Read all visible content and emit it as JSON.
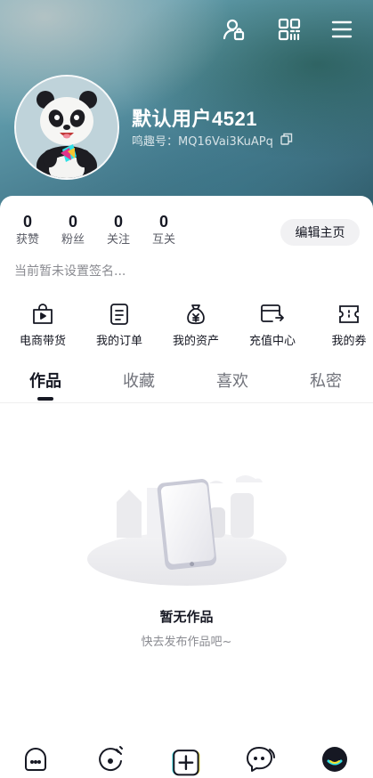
{
  "profile": {
    "username": "默认用户4521",
    "id_label": "鸣趣号：MQ16Vai3KuAPq"
  },
  "icons": {
    "add_friend": "person-add-icon",
    "qr_code": "qr-code-icon",
    "menu": "menu-icon",
    "copy": "copy-icon"
  },
  "stats": [
    {
      "value": "0",
      "label": "获赞"
    },
    {
      "value": "0",
      "label": "粉丝"
    },
    {
      "value": "0",
      "label": "关注"
    },
    {
      "value": "0",
      "label": "互关"
    }
  ],
  "edit_button": "编辑主页",
  "bio": "当前暂未设置签名...",
  "services": [
    {
      "label": "电商带货",
      "icon": "shopping-bag-play-icon"
    },
    {
      "label": "我的订单",
      "icon": "order-document-icon"
    },
    {
      "label": "我的资产",
      "icon": "money-bag-icon"
    },
    {
      "label": "充值中心",
      "icon": "recharge-card-icon"
    },
    {
      "label": "我的券",
      "icon": "coupon-icon"
    }
  ],
  "tabs": [
    {
      "label": "作品",
      "active": true
    },
    {
      "label": "收藏",
      "active": false
    },
    {
      "label": "喜欢",
      "active": false
    },
    {
      "label": "私密",
      "active": false
    }
  ],
  "empty_state": {
    "title": "暂无作品",
    "subtitle": "快去发布作品吧~"
  },
  "bottom_nav": [
    {
      "icon": "home-chat-icon"
    },
    {
      "icon": "discover-icon"
    },
    {
      "icon": "publish-plus-icon"
    },
    {
      "icon": "messages-icon"
    },
    {
      "icon": "profile-avatar-icon"
    }
  ],
  "colors": {
    "accent_yellow": "#f6e52e",
    "accent_cyan": "#2fe0e6",
    "text_primary": "#161823",
    "text_secondary": "#8a8b91"
  }
}
